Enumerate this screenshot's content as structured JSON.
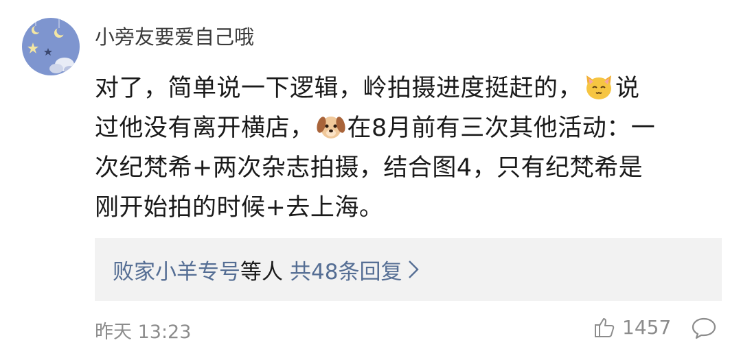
{
  "comment": {
    "username": "小旁友要爱自己哦",
    "body_lines": {
      "l1a": "对了，简单说一下逻辑，岭拍摄进度挺赶的，",
      "l1b": "说",
      "l2a": "过他没有离开横店，",
      "l2b": "在8月前有三次其他活动：一",
      "l3": "次纪梵希+两次杂志拍摄，结合图4，只有纪梵希是",
      "l4": "刚开始拍的时候+去上海。"
    },
    "emojis": [
      "cat-face-emoji",
      "dog-face-emoji"
    ],
    "replies": {
      "name": "败家小羊专号",
      "mid": "等人",
      "count_text": "共48条回复"
    },
    "timestamp": "昨天 13:23",
    "likes": "1457"
  },
  "colors": {
    "link": "#556e94",
    "meta": "#8c8c8c",
    "reply_bg": "#f2f2f2",
    "avatar_bg": "#7e95cf"
  }
}
